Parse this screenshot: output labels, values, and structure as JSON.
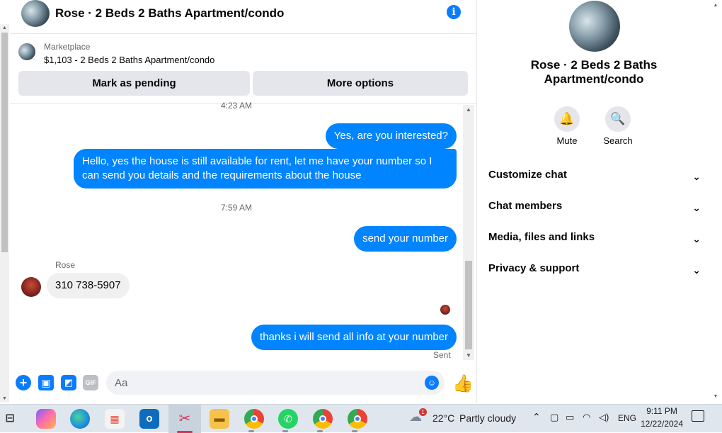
{
  "header": {
    "title": "Rose · 2 Beds 2 Baths Apartment/condo"
  },
  "marketplace": {
    "label": "Marketplace",
    "listing": "$1,103 - 2 Beds 2 Baths Apartment/condo",
    "mark_pending": "Mark as pending",
    "more_options": "More options"
  },
  "messages": {
    "time1": "4:23 AM",
    "m1": "Yes, are you interested?",
    "m2": "Hello, yes the house is still available for rent, let me have your number so I can send you details and the requirements about the house",
    "time2": "7:59 AM",
    "m3": "send your number",
    "sender": "Rose",
    "m4": "310 738-5907",
    "m5": "thanks i will send all info at your number",
    "status": "Sent"
  },
  "composer": {
    "placeholder": "Aa"
  },
  "right_panel": {
    "title": "Rose · 2 Beds 2 Baths Apartment/condo",
    "mute": "Mute",
    "search": "Search",
    "sections": [
      "Customize chat",
      "Chat members",
      "Media, files and links",
      "Privacy & support"
    ]
  },
  "taskbar": {
    "weather_badge": "1",
    "temperature": "22°C",
    "weather": "Partly cloudy",
    "language": "ENG",
    "time": "9:11 PM",
    "date": "12/22/2024"
  },
  "icons": {
    "info": "info-icon",
    "plus": "plus-icon",
    "image": "image-icon",
    "sticker": "sticker-icon",
    "gif": "gif-icon",
    "emoji": "emoji-icon",
    "like": "thumbs-up-icon",
    "bell": "bell-icon",
    "search": "search-icon"
  },
  "colors": {
    "accent": "#0084ff",
    "bubble_in": "#f0f0f0",
    "taskbar": "#dfe6ee"
  }
}
